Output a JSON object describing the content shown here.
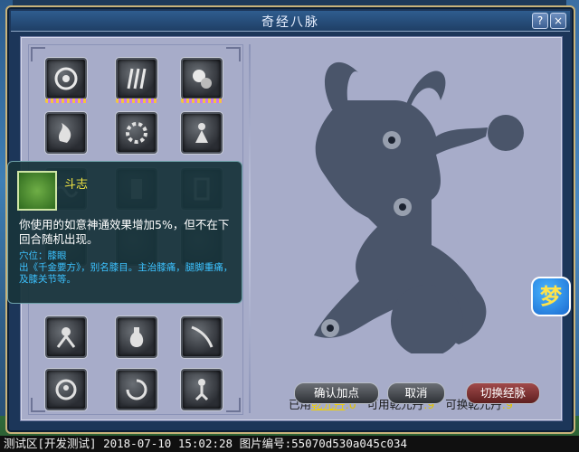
{
  "window": {
    "title": "奇经八脉",
    "help_label": "?",
    "close_label": "×"
  },
  "skills": [
    {
      "name": "skill-1",
      "icon": "swirl-icon",
      "learned": true
    },
    {
      "name": "skill-2",
      "icon": "claw-icon",
      "learned": true
    },
    {
      "name": "skill-3",
      "icon": "beast-icon",
      "learned": true
    },
    {
      "name": "skill-4",
      "icon": "flame-hand-icon",
      "learned": false
    },
    {
      "name": "skill-5",
      "icon": "gear-icon",
      "learned": false
    },
    {
      "name": "skill-6",
      "icon": "figure-icon",
      "learned": false
    },
    {
      "name": "skill-7",
      "icon": "wave-icon",
      "learned": false
    },
    {
      "name": "skill-8",
      "icon": "pillar-icon",
      "learned": false
    },
    {
      "name": "skill-9",
      "icon": "door-icon",
      "learned": false
    },
    {
      "name": "skill-10",
      "icon": "warrior-icon",
      "learned": false
    },
    {
      "name": "skill-11",
      "icon": "bottle-icon",
      "learned": false
    },
    {
      "name": "skill-12",
      "icon": "curtain-icon",
      "learned": false
    },
    {
      "name": "skill-13",
      "icon": "monk-icon",
      "learned": false
    },
    {
      "name": "skill-14",
      "icon": "vortex-icon",
      "learned": false
    },
    {
      "name": "skill-15",
      "icon": "runner-icon",
      "learned": false
    }
  ],
  "tooltip": {
    "title": "斗志",
    "description": "你使用的如意神通效果增加5%，但不在下回合随机出现。",
    "acupoint_label": "穴位：膝眼",
    "acupoint_detail": "出《千金要方》，别名膝目。主治膝痛，腿脚重痛，及膝关节等。"
  },
  "legend": {
    "used_prefix": "已用",
    "used_item": "乾元丹",
    "used_value": ":0",
    "available_label": "可用乾元丹",
    "available_value": ":9",
    "exchangeable_label": "可换乾元丹",
    "exchangeable_value": ":9"
  },
  "buttons": {
    "confirm": "确认加点",
    "cancel": "取消",
    "switch": "切换经脉"
  },
  "logo_text": "梦",
  "status_bar": "测试区[开发测试]  2018-07-10 15:02:28 图片编号:55070d530a045c034",
  "colors": {
    "accent_yellow": "#f0d000",
    "tooltip_title": "#f2e544",
    "acupoint_blue": "#3cc2ff"
  }
}
